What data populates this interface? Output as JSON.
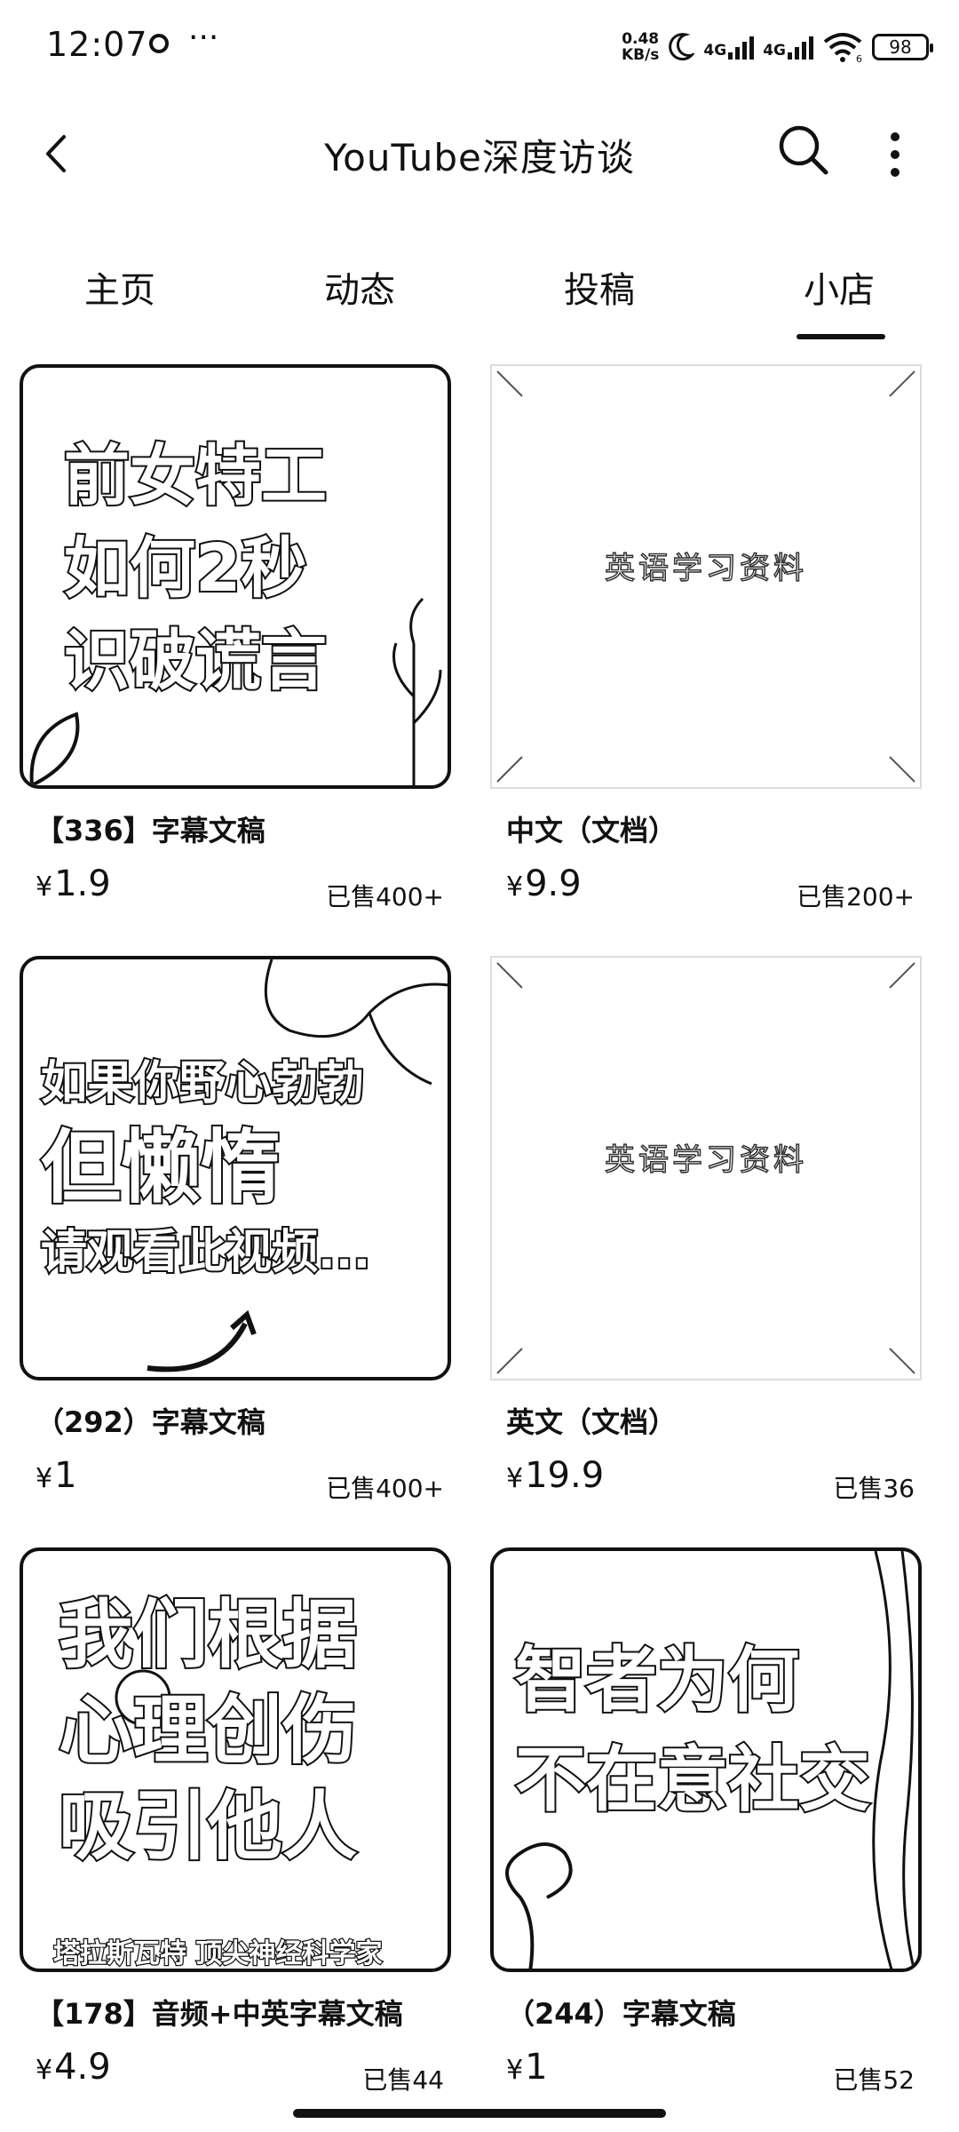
{
  "status_bar": {
    "time": "12:07",
    "more": "···",
    "net_speed": "0.48",
    "net_unit": "KB/s",
    "sim1": "4G",
    "sim2": "4G",
    "wifi_badge": "6",
    "battery": "98"
  },
  "header": {
    "title": "YouTube深度访谈"
  },
  "tabs": [
    {
      "label": "主页"
    },
    {
      "label": "动态"
    },
    {
      "label": "投稿"
    },
    {
      "label": "小店"
    }
  ],
  "active_tab": "小店",
  "products": [
    {
      "cover_lines": [
        "前女特工",
        "如何2秒",
        "识破谎言"
      ],
      "name": "【336】字幕文稿",
      "currency": "¥",
      "price": "1.9",
      "sold": "已售400+"
    },
    {
      "cover_placeholder": "英语学习资料",
      "name": "中文（文档）",
      "currency": "¥",
      "price": "9.9",
      "sold": "已售200+"
    },
    {
      "cover_lines": [
        "如果你野心勃勃",
        "但懒惰",
        "请观看此视频..."
      ],
      "name": "（292）字幕文稿",
      "currency": "¥",
      "price": "1",
      "sold": "已售400+"
    },
    {
      "cover_placeholder": "英语学习资料",
      "name": "英文（文档）",
      "currency": "¥",
      "price": "19.9",
      "sold": "已售36"
    },
    {
      "cover_lines": [
        "我们根据",
        "心理创伤",
        "吸引他人"
      ],
      "cover_caption": "塔拉斯瓦特 顶尖神经科学家",
      "name": "【178】音频+中英字幕文稿",
      "currency": "¥",
      "price": "4.9",
      "sold": "已售44"
    },
    {
      "cover_lines": [
        "智者为何",
        "不在意社交"
      ],
      "name": "（244）字幕文稿",
      "currency": "¥",
      "price": "1",
      "sold": "已售52"
    }
  ]
}
